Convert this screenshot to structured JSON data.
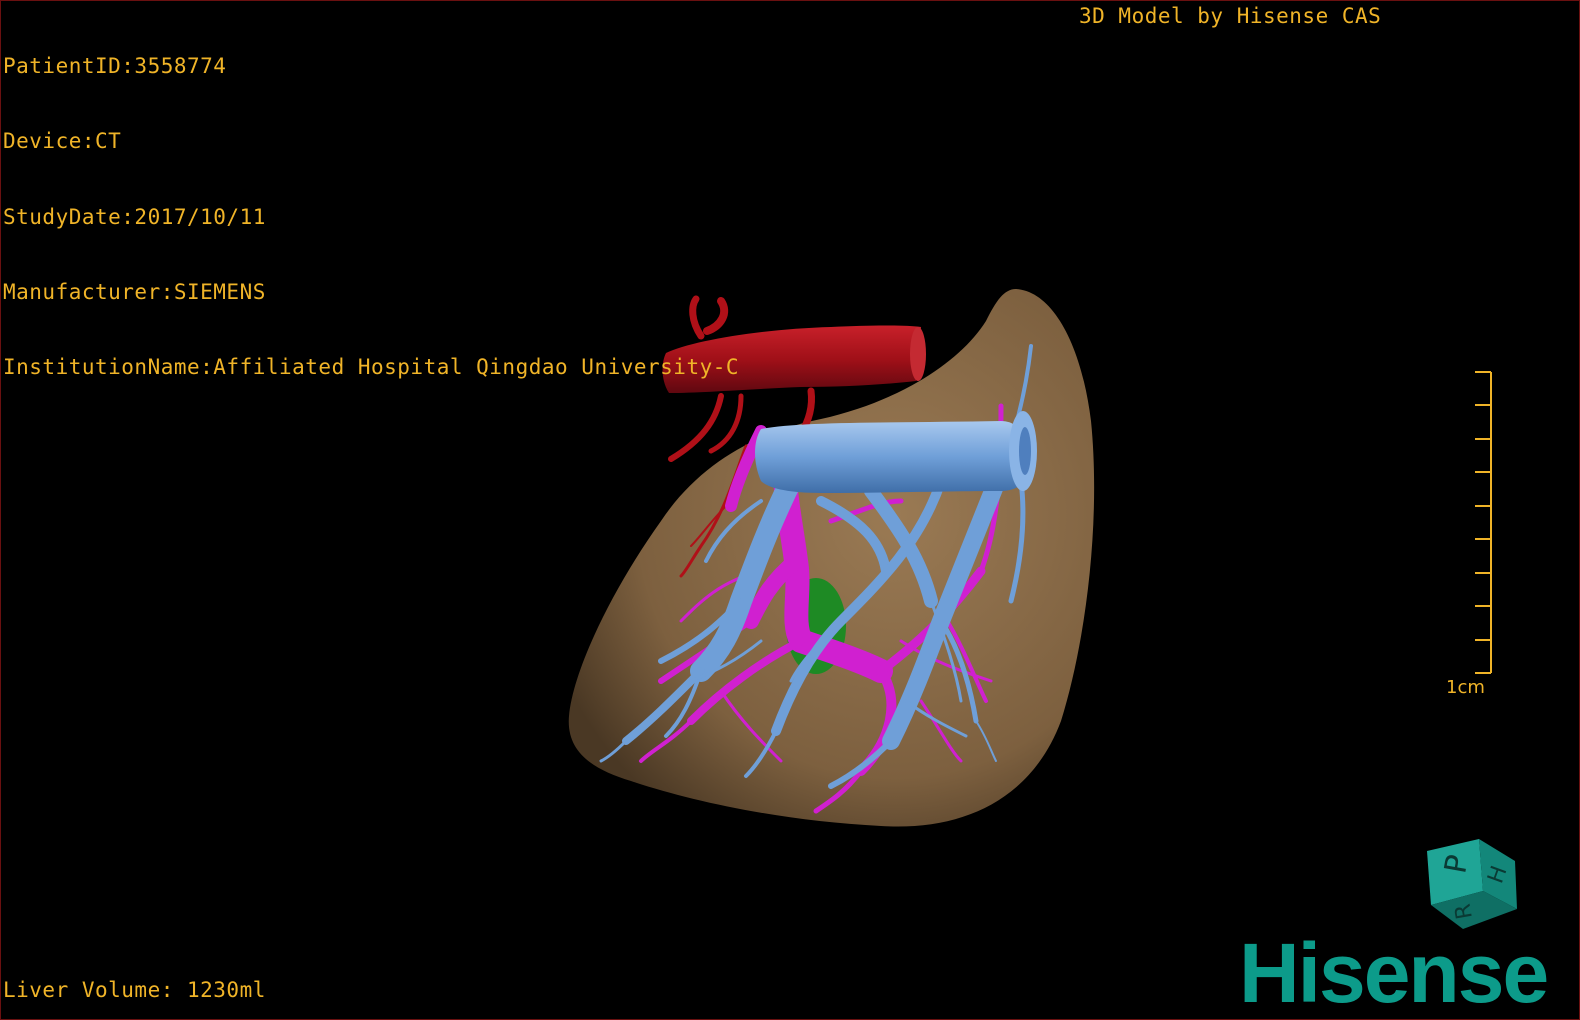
{
  "header": {
    "patient_id": "PatientID:3558774",
    "device": "Device:CT",
    "study_date": "StudyDate:2017/10/11",
    "manufacturer": "Manufacturer:SIEMENS",
    "institution": "InstitutionName:Affiliated Hospital Qingdao University-C"
  },
  "title_right": "3D Model by Hisense CAS",
  "footer": {
    "liver_volume": "Liver Volume: 1230ml"
  },
  "scale_bar": {
    "label": "1cm"
  },
  "brand": {
    "name": "Hisense"
  },
  "orientation_cube": {
    "faces": [
      "P",
      "H",
      "R"
    ]
  },
  "colors": {
    "overlay_text": "#f0b428",
    "liver": "#8a6a47",
    "hepatic_vein": "#6f9fd8",
    "portal_vein": "#d020d0",
    "hepatic_artery": "#b01018",
    "lesion": "#1e8a24",
    "brand": "#0c9b8a"
  }
}
